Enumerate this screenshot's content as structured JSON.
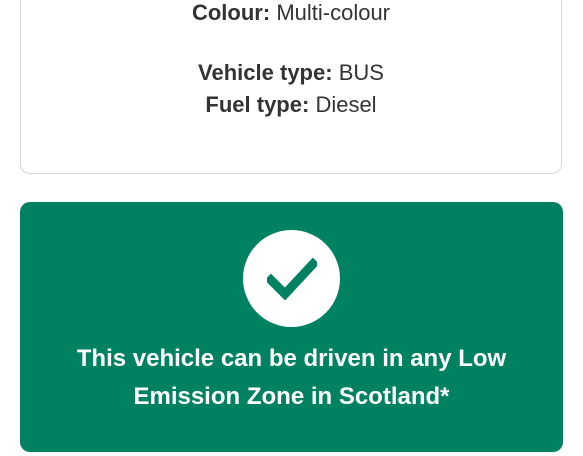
{
  "vehicle_details": {
    "colour_label": "Colour:",
    "colour_value": "Multi-colour",
    "vehicle_type_label": "Vehicle type:",
    "vehicle_type_value": "BUS",
    "fuel_type_label": "Fuel type:",
    "fuel_type_value": "Diesel"
  },
  "result": {
    "icon": "check-icon",
    "status_color": "#008161",
    "message": "This vehicle can be driven in any Low Emission Zone in Scotland*"
  }
}
